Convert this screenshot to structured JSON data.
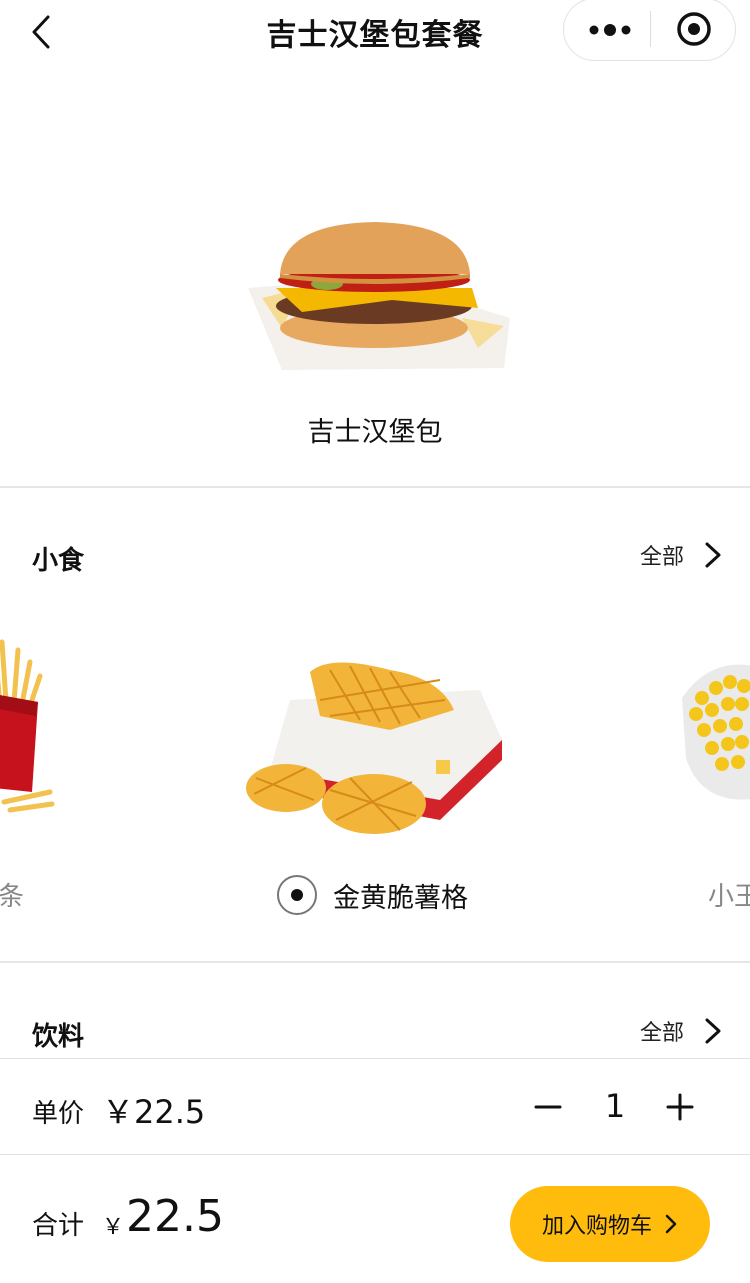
{
  "nav": {
    "title": "吉士汉堡包套餐"
  },
  "main_item": {
    "name": "吉士汉堡包"
  },
  "snacks": {
    "title": "小食",
    "see_all": "全部",
    "items": [
      {
        "label": "条",
        "selected": false
      },
      {
        "label": "金黄脆薯格",
        "selected": true
      },
      {
        "label": "小王",
        "selected": false
      }
    ]
  },
  "drinks": {
    "title": "饮料",
    "see_all": "全部"
  },
  "unit_price": {
    "label": "单价",
    "value": "￥22.5"
  },
  "quantity": {
    "value": "1"
  },
  "total": {
    "label": "合计",
    "currency": "￥",
    "value": "22.5"
  },
  "cart_button": {
    "label": "加入购物车"
  },
  "colors": {
    "accent": "#ffbc0d",
    "divider": "#e6e6e6"
  }
}
